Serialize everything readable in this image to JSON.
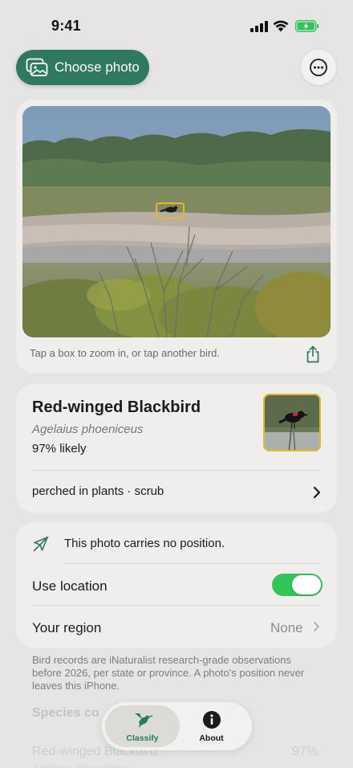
{
  "status_bar": {
    "time": "9:41",
    "battery_color": "#34c359"
  },
  "toolbar": {
    "choose_photo_label": "Choose photo",
    "choose_photo_icon": "photo-stack-icon",
    "more_icon": "ellipsis-circle-icon",
    "accent_color": "#2f7a5e"
  },
  "photo_card": {
    "hint": "Tap a box to zoom in, or tap another bird.",
    "share_icon": "share-icon",
    "box_color": "#e6b72b"
  },
  "result": {
    "common_name": "Red-winged Blackbird",
    "scientific_name": "Agelaius phoeniceus",
    "likelihood": "97% likely",
    "habitat": "perched in plants · scrub"
  },
  "location": {
    "note": "This photo carries no position.",
    "note_icon": "location-slash-icon",
    "use_location_label": "Use location",
    "use_location_on": true,
    "region_label": "Your region",
    "region_value": "None"
  },
  "footnote": "Bird records are iNaturalist research-grade observations before 2026, per state or province. A photo's position never leaves this iPhone.",
  "below_fold": {
    "section_title": "Species co",
    "row_name": "Red-winged Blackbird",
    "row_pct": "97%",
    "row_sci": "Agelaius phoeniceus"
  },
  "tab_bar": {
    "tabs": [
      {
        "label": "Classify",
        "icon": "hummingbird-icon",
        "active": true
      },
      {
        "label": "About",
        "icon": "info-circle-icon",
        "active": false
      }
    ]
  }
}
